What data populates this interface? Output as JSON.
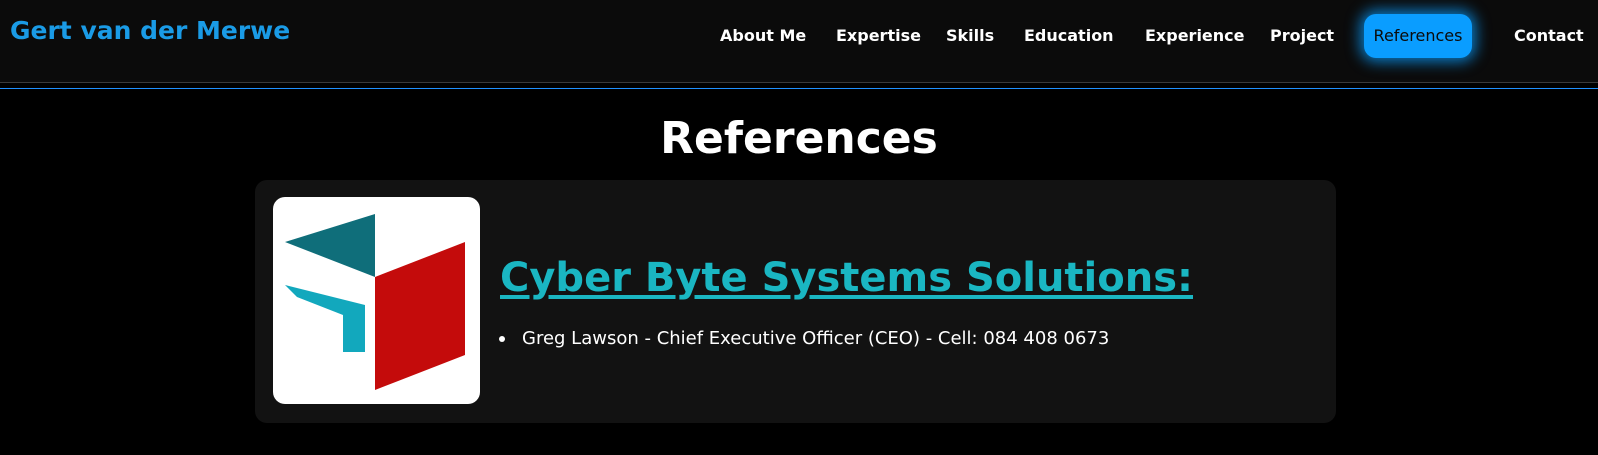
{
  "header": {
    "brand": "Gert van der Merwe",
    "nav": [
      {
        "label": "About Me"
      },
      {
        "label": "Expertise"
      },
      {
        "label": "Skills"
      },
      {
        "label": "Education"
      },
      {
        "label": "Experience"
      },
      {
        "label": "Project"
      },
      {
        "label": "References",
        "active": true
      },
      {
        "label": "Contact"
      }
    ]
  },
  "main": {
    "title": "References",
    "references": [
      {
        "company": "Cyber Byte Systems Solutions:",
        "logo_icon": "cyber-byte-logo",
        "contacts": [
          "Greg Lawson - Chief Executive Officer (CEO) - Cell: 084 408 0673"
        ]
      }
    ]
  },
  "colors": {
    "accent": "#0a9dff",
    "brand": "#1a9be6",
    "company_link": "#1ab6c2",
    "logo_red": "#c40b0b",
    "logo_teal": "#0f6e7a",
    "logo_cyan": "#12a8bd"
  }
}
